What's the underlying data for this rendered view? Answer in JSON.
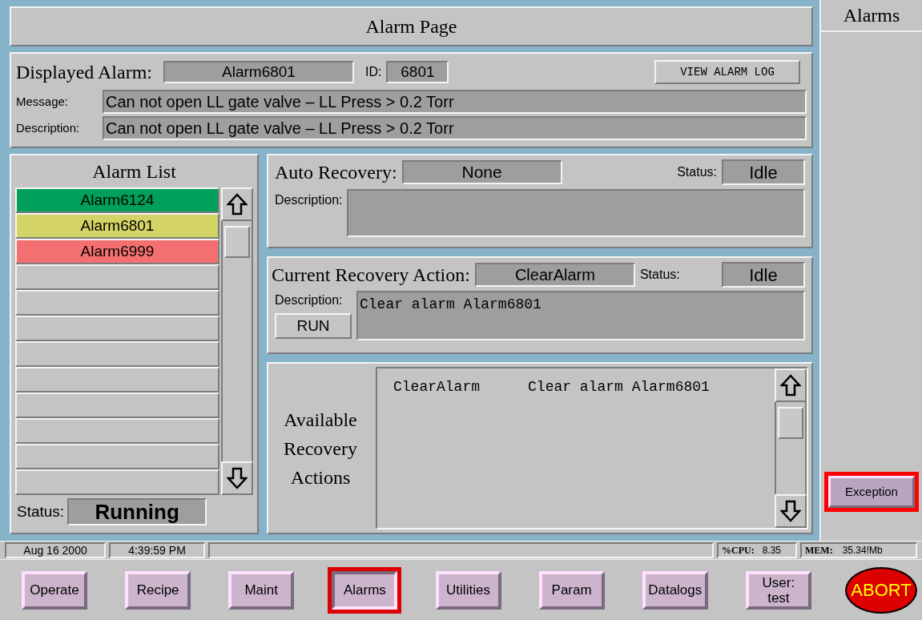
{
  "title": "Alarm Page",
  "side_panel": {
    "title": "Alarms",
    "button": {
      "label": "Exception",
      "highlighted": true
    }
  },
  "displayed_alarm": {
    "label": "Displayed Alarm:",
    "name": "Alarm6801",
    "id_label": "ID:",
    "id": "6801",
    "log_button": "VIEW ALARM LOG",
    "message_label": "Message:",
    "message": "Can not open LL gate valve – LL Press > 0.2 Torr",
    "description_label": "Description:",
    "description": "Can not open LL gate valve – LL Press > 0.2 Torr"
  },
  "alarm_list": {
    "title": "Alarm List",
    "items": [
      {
        "name": "Alarm6124",
        "color": "#00a05a"
      },
      {
        "name": "Alarm6801",
        "color": "#d4d466"
      },
      {
        "name": "Alarm6999",
        "color": "#f47070"
      }
    ],
    "status_label": "Status:",
    "status": "Running"
  },
  "auto_recovery": {
    "label": "Auto Recovery:",
    "value": "None",
    "status_label": "Status:",
    "status": "Idle",
    "description_label": "Description:"
  },
  "current_recovery": {
    "label": "Current Recovery Action:",
    "value": "ClearAlarm",
    "status_label": "Status:",
    "status": "Idle",
    "description_label": "Description:",
    "description": "Clear alarm Alarm6801",
    "run_button": "RUN"
  },
  "available_actions": {
    "title": "Available Recovery Actions",
    "rows": [
      {
        "name": "ClearAlarm",
        "description": "Clear alarm Alarm6801"
      }
    ]
  },
  "status_bar": {
    "date": "Aug 16 2000",
    "time": "4:39:59 PM",
    "cpu_label": "%CPU:",
    "cpu": "8.35",
    "mem_label": "MEM:",
    "mem": "35.34!Mb"
  },
  "nav": [
    {
      "label": "Operate",
      "kind": "button",
      "selected": false
    },
    {
      "label": "Recipe",
      "kind": "button",
      "selected": false
    },
    {
      "label": "Maint",
      "kind": "button",
      "selected": false
    },
    {
      "label": "Alarms",
      "kind": "button",
      "selected": true
    },
    {
      "label": "Utilities",
      "kind": "button",
      "selected": false
    },
    {
      "label": "Param",
      "kind": "button",
      "selected": false
    },
    {
      "label": "Datalogs",
      "kind": "button",
      "selected": false
    },
    {
      "label": "User:\ntest",
      "kind": "button",
      "selected": false
    },
    {
      "label": "ABORT",
      "kind": "abort",
      "selected": false
    }
  ]
}
